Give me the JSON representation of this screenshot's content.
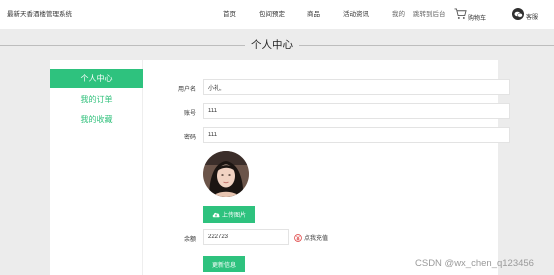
{
  "header": {
    "site_title": "最新天香酒楼管理系统",
    "nav": [
      {
        "label": "首页",
        "muted": false
      },
      {
        "label": "包间预定",
        "muted": false
      },
      {
        "label": "商品",
        "muted": false
      },
      {
        "label": "活动资讯",
        "muted": false
      },
      {
        "label": "我的",
        "muted": true
      },
      {
        "label": "跳转到后台",
        "muted": true
      }
    ],
    "cart_label": "购物车",
    "support_label": "客服"
  },
  "page_title": "个人中心",
  "sidebar": {
    "items": [
      {
        "label": "个人中心",
        "active": true
      },
      {
        "label": "我的订单",
        "active": false
      },
      {
        "label": "我的收藏",
        "active": false
      }
    ]
  },
  "form": {
    "username": {
      "label": "用户名",
      "value": "小礼,"
    },
    "account": {
      "label": "账号",
      "value": "111"
    },
    "password": {
      "label": "密码",
      "value": "111"
    },
    "upload_label": "上传图片",
    "balance": {
      "label": "余额",
      "value": "222723"
    },
    "recharge_label": "点我充值",
    "submit_label": "更新信息"
  },
  "colors": {
    "accent": "#2ec27e",
    "accent_text": "#2ec07a",
    "background": "#ececec"
  },
  "watermark": "CSDN @wx_chen_q123456"
}
